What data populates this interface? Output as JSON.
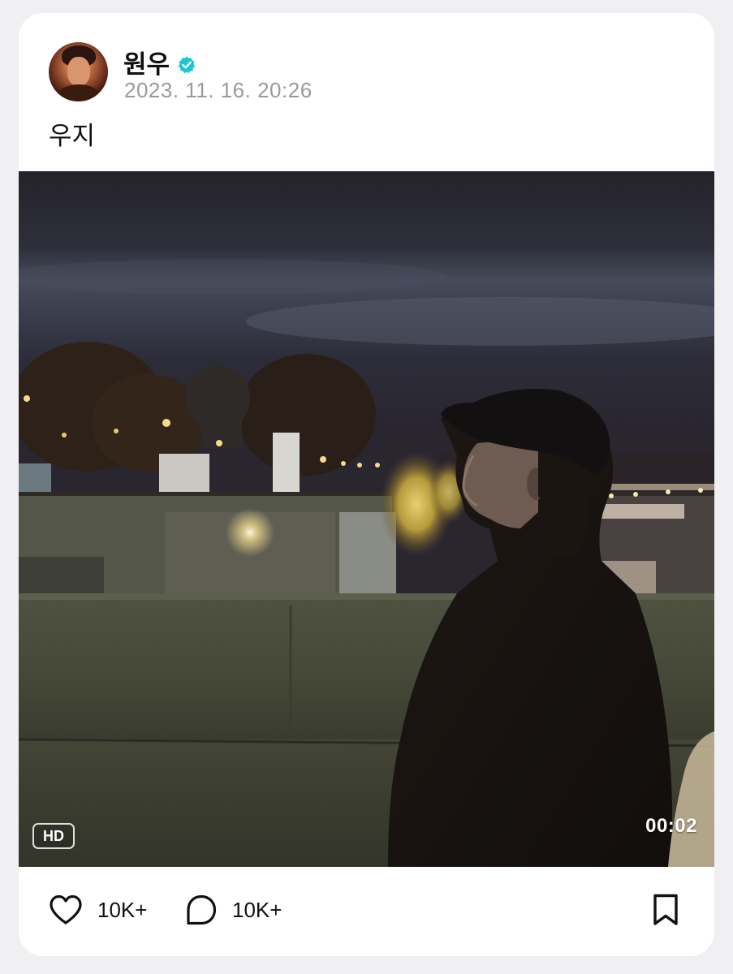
{
  "post": {
    "author": "원우",
    "verified": true,
    "timestamp": "2023. 11. 16. 20:26",
    "caption": "우지"
  },
  "media": {
    "type": "video",
    "quality_badge": "HD",
    "duration": "00:02"
  },
  "actions": {
    "like_count": "10K+",
    "comment_count": "10K+"
  },
  "icons": {
    "verified": "verified-badge-icon",
    "like": "heart-icon",
    "comment": "comment-bubble-icon",
    "bookmark": "bookmark-icon"
  },
  "colors": {
    "verified_badge": "#21c4d6",
    "timestamp": "#9a9a9e",
    "background": "#f0f0f2",
    "card": "#ffffff"
  }
}
